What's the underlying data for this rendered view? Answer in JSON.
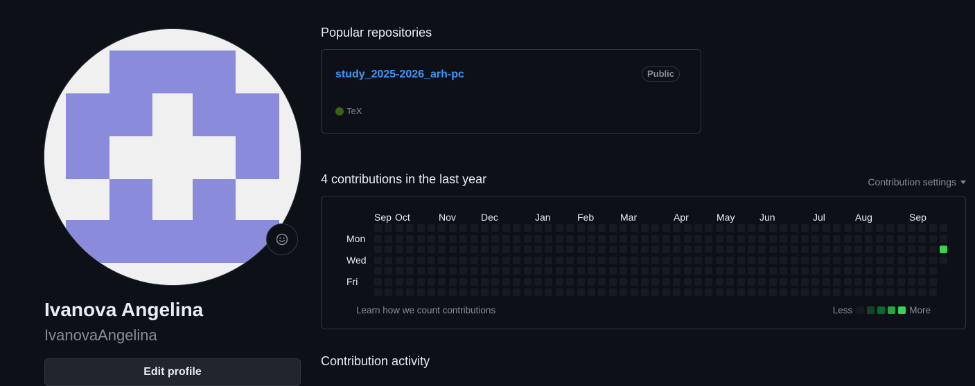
{
  "profile": {
    "full_name": "Ivanova Angelina",
    "username": "IvanovaAngelina",
    "edit_button": "Edit profile",
    "avatar_colors": {
      "background": "#f0f0f0",
      "fill": "#8a8cdb"
    }
  },
  "popular": {
    "title": "Popular repositories",
    "repos": [
      {
        "name": "study_2025-2026_arh-pc",
        "visibility": "Public",
        "language": "TeX",
        "language_color": "#3d6117"
      }
    ]
  },
  "contributions": {
    "title": "4 contributions in the last year",
    "settings_label": "Contribution settings",
    "months": [
      "Sep",
      "Oct",
      "Nov",
      "Dec",
      "Jan",
      "Feb",
      "Mar",
      "Apr",
      "May",
      "Jun",
      "Jul",
      "Aug",
      "Sep"
    ],
    "day_labels": [
      "Mon",
      "Wed",
      "Fri"
    ],
    "learn_link": "Learn how we count contributions",
    "legend_less": "Less",
    "legend_more": "More",
    "colors": {
      "empty": "#161b22",
      "level1": "#0e4429",
      "level2": "#006d32",
      "level3": "#26a641",
      "level4": "#39d353"
    },
    "active_cells": [
      {
        "week": 53,
        "day": 2,
        "level": 4
      }
    ]
  },
  "activity": {
    "title": "Contribution activity"
  }
}
